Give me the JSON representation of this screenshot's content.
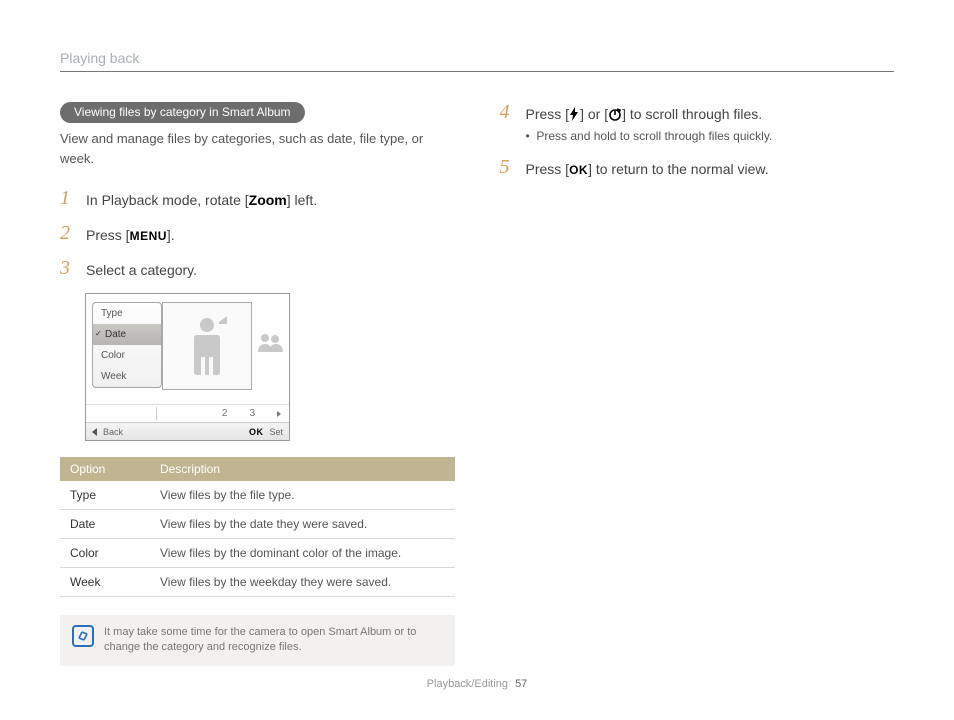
{
  "header": {
    "title": "Playing back"
  },
  "section": {
    "pill": "Viewing files by category in Smart Album",
    "intro": "View and manage files by categories, such as date, file type, or week."
  },
  "steps_left": [
    {
      "n": "1",
      "pre": "In Playback mode, rotate [",
      "token": "Zoom",
      "post": "] left."
    },
    {
      "n": "2",
      "pre": "Press [",
      "token": "MENU",
      "post": "]."
    },
    {
      "n": "3",
      "text": "Select a category."
    }
  ],
  "camera_ui": {
    "menu": [
      "Type",
      "Date",
      "Color",
      "Week"
    ],
    "selected_index": 1,
    "pager": {
      "p2": "2",
      "p3": "3"
    },
    "bottom": {
      "back": "Back",
      "ok": "OK",
      "set": "Set"
    }
  },
  "table": {
    "headers": [
      "Option",
      "Description"
    ],
    "rows": [
      [
        "Type",
        "View files by the file type."
      ],
      [
        "Date",
        "View files by the date they were saved."
      ],
      [
        "Color",
        "View files by the dominant color of the image."
      ],
      [
        "Week",
        "View files by the weekday they were saved."
      ]
    ]
  },
  "note": "It may take some time for the camera to open Smart Album or to change the category and recognize files.",
  "steps_right": [
    {
      "n": "4",
      "parts": [
        "Press [",
        "] or [",
        "] to scroll through files."
      ],
      "sub_bullet": "Press and hold to scroll through files quickly."
    },
    {
      "n": "5",
      "pre": "Press [",
      "token": "OK",
      "post": "] to return to the normal view."
    }
  ],
  "footer": {
    "section": "Playback/Editing",
    "page": "57"
  }
}
